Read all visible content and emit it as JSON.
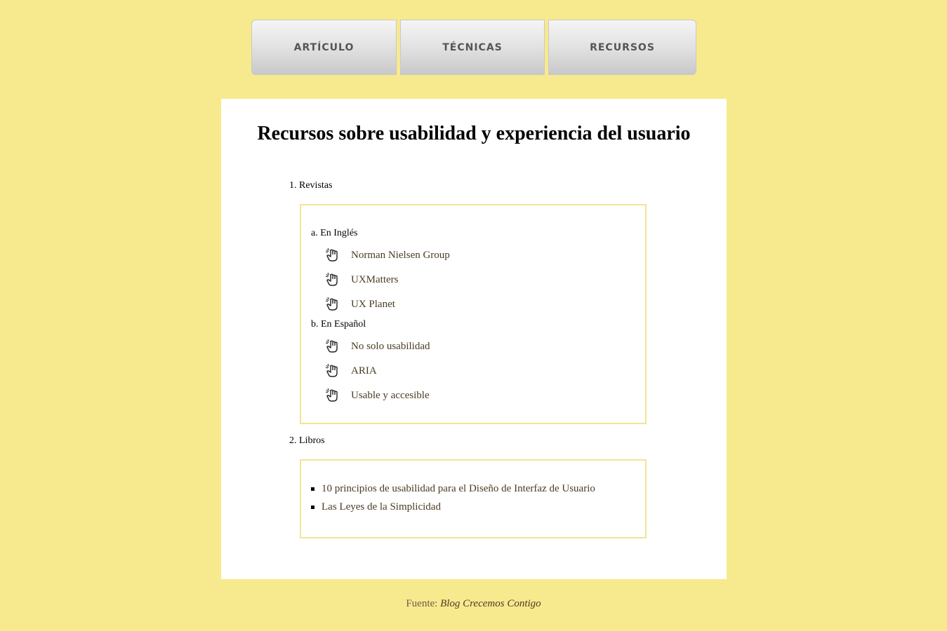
{
  "nav": {
    "items": [
      {
        "label": "ARTÍCULO"
      },
      {
        "label": "TÉCNICAS"
      },
      {
        "label": "RECURSOS"
      }
    ]
  },
  "main": {
    "title": "Recursos sobre usabilidad y experiencia del usuario",
    "sections": [
      {
        "label": "1. Revistas",
        "groups": [
          {
            "label": "a. En Inglés",
            "links": [
              {
                "text": "Norman Nielsen Group",
                "icon": "pointing-hand-icon"
              },
              {
                "text": "UXMatters",
                "icon": "pointing-hand-icon"
              },
              {
                "text": "UX Planet",
                "icon": "pointing-hand-icon"
              }
            ]
          },
          {
            "label": "b. En Español",
            "links": [
              {
                "text": "No solo usabilidad",
                "icon": "pointing-hand-icon"
              },
              {
                "text": "ARIA",
                "icon": "pointing-hand-icon"
              },
              {
                "text": "Usable y accesible",
                "icon": "pointing-hand-icon"
              }
            ]
          }
        ]
      },
      {
        "label": "2. Libros",
        "items": [
          {
            "text": "10 principios de usabilidad para el Diseño de Interfaz de Usuario"
          },
          {
            "text": "Las Leyes de la Simplicidad"
          }
        ]
      }
    ]
  },
  "footer": {
    "prefix": "Fuente:",
    "source": "Blog Crecemos Contigo"
  },
  "colors": {
    "background": "#f7e98e",
    "card": "#ffffff",
    "box_border": "#f3e495",
    "link_text": "#4a3c22"
  }
}
